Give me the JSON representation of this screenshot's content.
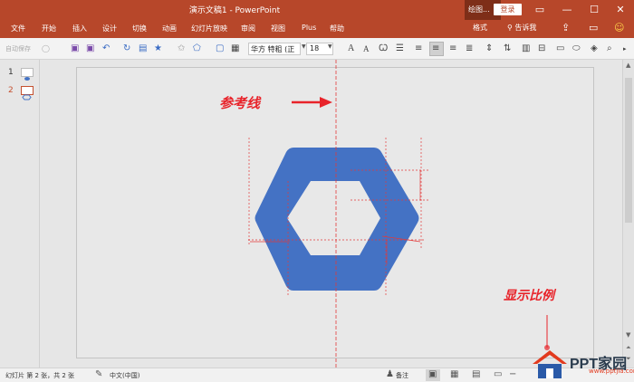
{
  "window": {
    "title": "演示文稿1  -  PowerPoint",
    "context_title": "绘图...",
    "login_label": "登录",
    "controls": [
      "ribbon-display-icon",
      "minimize-icon",
      "restore-icon",
      "close-icon"
    ]
  },
  "menu": {
    "items": [
      "文件",
      "开始",
      "插入",
      "设计",
      "切换",
      "动画",
      "幻灯片放映",
      "审阅",
      "视图",
      "Plus",
      "帮助"
    ],
    "context_tab": "格式",
    "tell_me": "告诉我"
  },
  "toolbar": {
    "autosave_label": "自动保存",
    "font_name": "华方 特粗 (正",
    "font_size": "18"
  },
  "slides": {
    "numbers": [
      "1",
      "2"
    ],
    "selected": 2
  },
  "annotations": {
    "guide_label": "参考线",
    "scale_label": "显示比例"
  },
  "shape": {
    "type": "hexagon-frame",
    "fill": "#4472c4"
  },
  "guide_color": "#e23a3a",
  "status": {
    "slide_info": "幻灯片 第 2 张，共 2 张",
    "language": "中文(中国)",
    "notes_label": "备注"
  },
  "watermark": {
    "text": "PPT家园",
    "subtext": "www.pptjia.com"
  },
  "colors": {
    "brand": "#b7472a",
    "context": "#7e2e18",
    "shape": "#4472c4"
  }
}
